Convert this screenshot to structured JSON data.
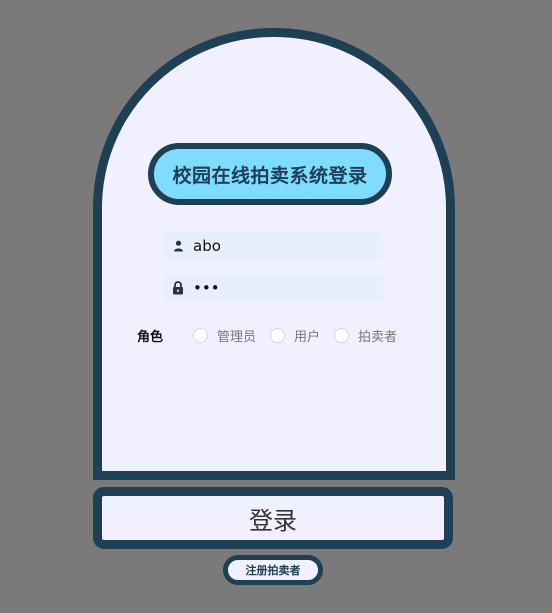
{
  "title": "校园在线拍卖系统登录",
  "form": {
    "username_value": "abo",
    "password_value": "•••",
    "role_label": "角色",
    "roles": [
      "管理员",
      "用户",
      "拍卖者"
    ]
  },
  "buttons": {
    "login": "登录",
    "register": "注册拍卖者"
  },
  "icons": {
    "username": "user-icon",
    "password": "lock-icon"
  },
  "colors": {
    "background": "#7a7a7a",
    "card": "#f0f0ff",
    "border": "#1f3f54",
    "title_pill": "#7fdcff",
    "input_bg": "#e7efff"
  }
}
